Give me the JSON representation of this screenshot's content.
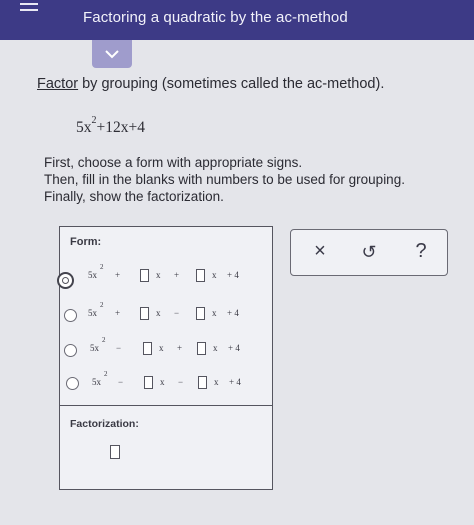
{
  "header": {
    "title": "Factoring a quadratic by the ac-method"
  },
  "intro": {
    "link": "Factor",
    "text": " by grouping (sometimes called the ac-method)."
  },
  "expression": {
    "coef": "5x",
    "power": "2",
    "rest": "+12x+4"
  },
  "instructions": [
    "First, choose a form with appropriate signs.",
    "Then, fill in the blanks with numbers to be used for grouping.",
    "Finally, show the factorization."
  ],
  "form": {
    "label": "Form:",
    "term": "5x",
    "power": "2",
    "x": "x",
    "constant": "+ 4",
    "options": [
      {
        "sign1": "+",
        "sign2": "+",
        "selected": true
      },
      {
        "sign1": "+",
        "sign2": "−",
        "selected": false
      },
      {
        "sign1": "−",
        "sign2": "+",
        "selected": false
      },
      {
        "sign1": "−",
        "sign2": "−",
        "selected": false
      }
    ],
    "factorization_label": "Factorization:"
  },
  "tools": {
    "clear": "×",
    "undo": "↺",
    "help": "?"
  }
}
